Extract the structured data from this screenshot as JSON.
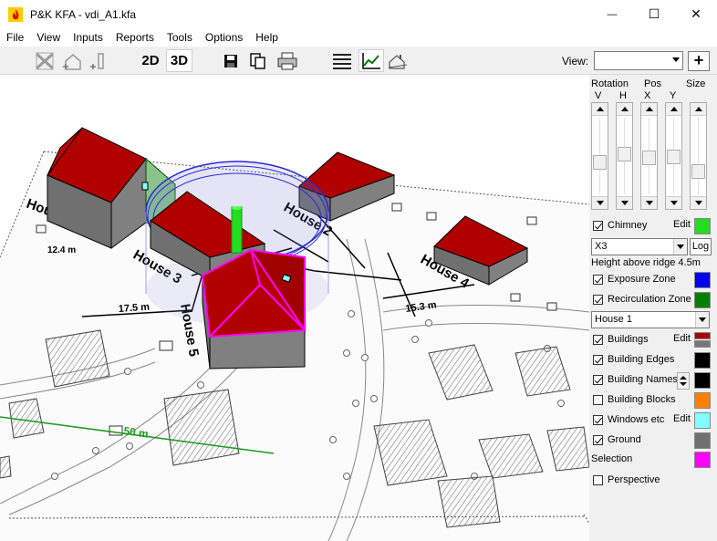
{
  "window": {
    "title": "P&K KFA - vdi_A1.kfa",
    "minimize_glyph": "—",
    "maximize_glyph": "☐",
    "close_glyph": "✕"
  },
  "menu": [
    "File",
    "View",
    "Inputs",
    "Reports",
    "Tools",
    "Options",
    "Help"
  ],
  "toolbar": {
    "btn_2d": "2D",
    "btn_3d": "3D",
    "view_label": "View:",
    "view_value": "",
    "add_label": "+",
    "icons": [
      "select-tool-icon",
      "add-building-icon",
      "add-chimney-icon",
      "save-icon",
      "copy-icon",
      "print-icon",
      "list-icon",
      "chart-icon",
      "terrain-icon"
    ]
  },
  "scene": {
    "house_labels": [
      "House 1",
      "House 2",
      "House 3",
      "House 4",
      "House 5"
    ],
    "dimensions": [
      "12.4 m",
      "17.5 m",
      "15.3 m",
      "50 m"
    ]
  },
  "panel": {
    "rotation_label": "Rotation",
    "pos_label": "Pos",
    "size_label": "Size",
    "v_label": "V",
    "h_label": "H",
    "x_label": "X",
    "y_label": "Y",
    "sliders": [
      0.58,
      0.46,
      0.52,
      0.5,
      0.72
    ],
    "chimney": {
      "label": "Chimney",
      "checked": true,
      "edit": "Edit",
      "color": "#22dd22"
    },
    "chimney_select": "X3",
    "log_label": "Log",
    "height_text": "Height above ridge 4.5m",
    "exposure": {
      "label": "Exposure Zone",
      "checked": true,
      "color": "#0000ee"
    },
    "recirculation": {
      "label": "Recirculation Zone",
      "checked": true,
      "color": "#008000"
    },
    "house_select": "House 1",
    "buildings": {
      "label": "Buildings",
      "checked": true,
      "edit": "Edit",
      "color_top": "#aa0000",
      "color_bottom": "#777777"
    },
    "building_edges": {
      "label": "Building Edges",
      "checked": true,
      "color": "#000000"
    },
    "building_names": {
      "label": "Building Names",
      "checked": true,
      "color": "#000000"
    },
    "building_blocks": {
      "label": "Building Blocks",
      "checked": false,
      "color": "#ff8000"
    },
    "windows": {
      "label": "Windows etc",
      "checked": true,
      "edit": "Edit",
      "color": "#80ffff"
    },
    "ground": {
      "label": "Ground",
      "checked": true,
      "color": "#707070"
    },
    "selection": {
      "label": "Selection",
      "color": "#ff00ff"
    },
    "perspective": {
      "label": "Perspective",
      "checked": false
    }
  }
}
